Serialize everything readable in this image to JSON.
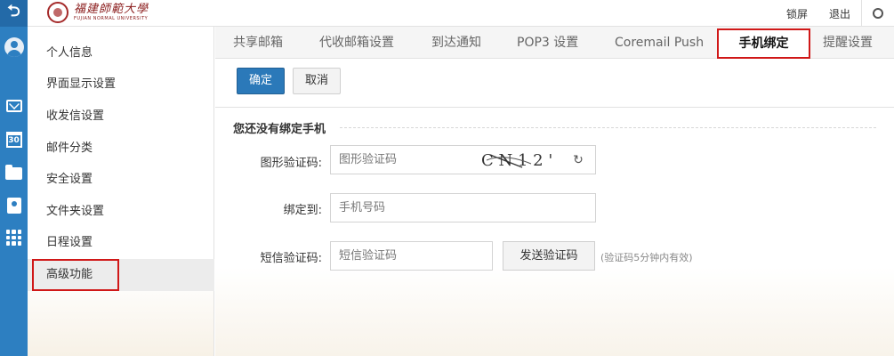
{
  "rail": {
    "back_icon": "back-arrow-icon",
    "avatar_icon": "avatar-icon",
    "items": [
      "mail-icon",
      "calendar-icon",
      "folder-icon",
      "contacts-icon",
      "apps-grid-icon"
    ],
    "calendar_day": "30"
  },
  "header": {
    "logo_cn": "福建師範大學",
    "logo_en": "FUJIAN NORMAL UNIVERSITY",
    "lock_label": "锁屏",
    "logout_label": "退出"
  },
  "sidebar": {
    "items": [
      {
        "label": "个人信息"
      },
      {
        "label": "界面显示设置"
      },
      {
        "label": "收发信设置"
      },
      {
        "label": "邮件分类"
      },
      {
        "label": "安全设置"
      },
      {
        "label": "文件夹设置"
      },
      {
        "label": "日程设置"
      },
      {
        "label": "高级功能",
        "active": true
      }
    ]
  },
  "tabs": [
    {
      "label": "共享邮箱"
    },
    {
      "label": "代收邮箱设置"
    },
    {
      "label": "到达通知"
    },
    {
      "label": "POP3 设置"
    },
    {
      "label": "Coremail Push"
    },
    {
      "label": "手机绑定",
      "active": true
    },
    {
      "label": "提醒设置"
    }
  ],
  "toolbar": {
    "confirm_label": "确定",
    "cancel_label": "取消"
  },
  "form": {
    "section_title": "您还没有绑定手机",
    "captcha_label": "图形验证码:",
    "captcha_placeholder": "图形验证码",
    "captcha_text": "C N 1 2 '",
    "phone_label": "绑定到:",
    "phone_placeholder": "手机号码",
    "sms_label": "短信验证码:",
    "sms_placeholder": "短信验证码",
    "send_sms_label": "发送验证码",
    "sms_hint": "(验证码5分钟内有效)"
  },
  "colors": {
    "rail": "#2d7fc1",
    "primary": "#2b79b9",
    "highlight": "#d01818"
  }
}
